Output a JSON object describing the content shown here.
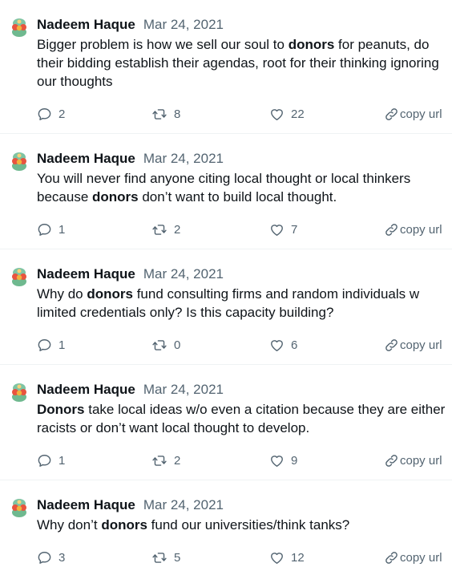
{
  "tweets": [
    {
      "author": "Nadeem Haque",
      "date": "Mar 24, 2021",
      "segments": [
        {
          "t": "Bigger problem is how we sell our soul to ",
          "b": false
        },
        {
          "t": "donors",
          "b": true
        },
        {
          "t": " for peanuts, do their bidding establish their agendas, root for their thinking ignoring our thoughts",
          "b": false
        }
      ],
      "replies": "2",
      "retweets": "8",
      "likes": "22",
      "copy_label": "copy url"
    },
    {
      "author": "Nadeem Haque",
      "date": "Mar 24, 2021",
      "segments": [
        {
          "t": "You will never find anyone citing local thought or local thinkers because ",
          "b": false
        },
        {
          "t": "donors",
          "b": true
        },
        {
          "t": " don’t want to build local thought.",
          "b": false
        }
      ],
      "replies": "1",
      "retweets": "2",
      "likes": "7",
      "copy_label": "copy url"
    },
    {
      "author": "Nadeem Haque",
      "date": "Mar 24, 2021",
      "segments": [
        {
          "t": "Why do ",
          "b": false
        },
        {
          "t": "donors",
          "b": true
        },
        {
          "t": " fund consulting firms and random individuals w limited credentials only? Is this capacity building?",
          "b": false
        }
      ],
      "replies": "1",
      "retweets": "0",
      "likes": "6",
      "copy_label": "copy url"
    },
    {
      "author": "Nadeem Haque",
      "date": "Mar 24, 2021",
      "segments": [
        {
          "t": "Donors",
          "b": true
        },
        {
          "t": " take local ideas w/o even a citation because they are either racists or don’t want local thought to develop.",
          "b": false
        }
      ],
      "replies": "1",
      "retweets": "2",
      "likes": "9",
      "copy_label": "copy url"
    },
    {
      "author": "Nadeem Haque",
      "date": "Mar 24, 2021",
      "segments": [
        {
          "t": "Why don’t ",
          "b": false
        },
        {
          "t": "donors",
          "b": true
        },
        {
          "t": " fund our universities/think tanks?",
          "b": false
        }
      ],
      "replies": "3",
      "retweets": "5",
      "likes": "12",
      "copy_label": "copy url"
    }
  ],
  "icons": {
    "reply": "reply-icon",
    "retweet": "retweet-icon",
    "like": "heart-icon",
    "copy": "link-icon",
    "avatar": "avatar-image"
  },
  "colors": {
    "text": "#0f1419",
    "muted": "#536471",
    "divider": "#eff3f4"
  }
}
